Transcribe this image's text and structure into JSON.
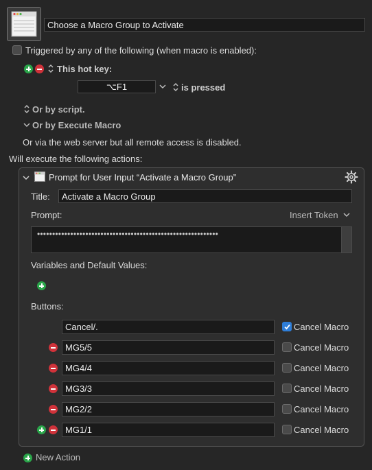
{
  "macro": {
    "name": "Choose a Macro Group to Activate"
  },
  "trigger": {
    "header": "Triggered by any of the following (when macro is enabled):",
    "hotkey_label": "This hot key:",
    "hotkey_value": "⌥F1",
    "hotkey_state": "is pressed",
    "or_script": "Or by script.",
    "or_execute": "Or by Execute Macro",
    "web_server": "Or via the web server but all remote access is disabled."
  },
  "actions_header": "Will execute the following actions:",
  "action": {
    "title_text": "Prompt for User Input “Activate a Macro Group”",
    "title_label": "Title:",
    "title_value": "Activate a Macro Group",
    "prompt_label": "Prompt:",
    "insert_token": "Insert Token",
    "prompt_value": "••••••••••••••••••••••••••••••••••••••••••••••••••••••••••••",
    "variables_label": "Variables and Default Values:",
    "buttons_label": "Buttons:",
    "cancel_label": "Cancel Macro",
    "buttons": [
      {
        "value": "Cancel/.",
        "cancel": true
      },
      {
        "value": "MG5/5",
        "cancel": false
      },
      {
        "value": "MG4/4",
        "cancel": false
      },
      {
        "value": "MG3/3",
        "cancel": false
      },
      {
        "value": "MG2/2",
        "cancel": false
      },
      {
        "value": "MG1/1",
        "cancel": false
      }
    ]
  },
  "new_action": "New Action"
}
